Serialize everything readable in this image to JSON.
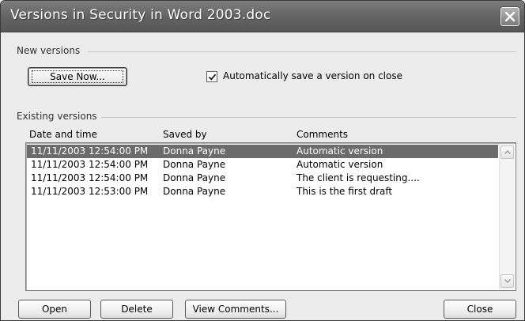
{
  "window": {
    "title": "Versions in Security in Word 2003.doc",
    "close_icon": "close-x-icon"
  },
  "new_versions": {
    "section_label": "New versions",
    "save_now_label": "Save Now...",
    "auto_save_checked": true,
    "auto_save_label": "Automatically save a version on close"
  },
  "existing_versions": {
    "section_label": "Existing versions",
    "columns": [
      "Date and time",
      "Saved by",
      "Comments"
    ],
    "rows": [
      {
        "date": "11/11/2003 12:54:00 PM",
        "saved_by": "Donna Payne",
        "comment": "Automatic version",
        "selected": true
      },
      {
        "date": "11/11/2003 12:54:00 PM",
        "saved_by": "Donna Payne",
        "comment": "Automatic version",
        "selected": false
      },
      {
        "date": "11/11/2003 12:54:00 PM",
        "saved_by": "Donna Payne",
        "comment": "The client is requesting....",
        "selected": false
      },
      {
        "date": "11/11/2003 12:53:00 PM",
        "saved_by": "Donna Payne",
        "comment": "This is the first draft",
        "selected": false
      }
    ]
  },
  "buttons": {
    "open": "Open",
    "delete": "Delete",
    "view_comments": "View Comments...",
    "close": "Close"
  },
  "colors": {
    "title_bar": "#626262",
    "selection": "#6b6b6b",
    "dialog_bg": "#ececec"
  }
}
